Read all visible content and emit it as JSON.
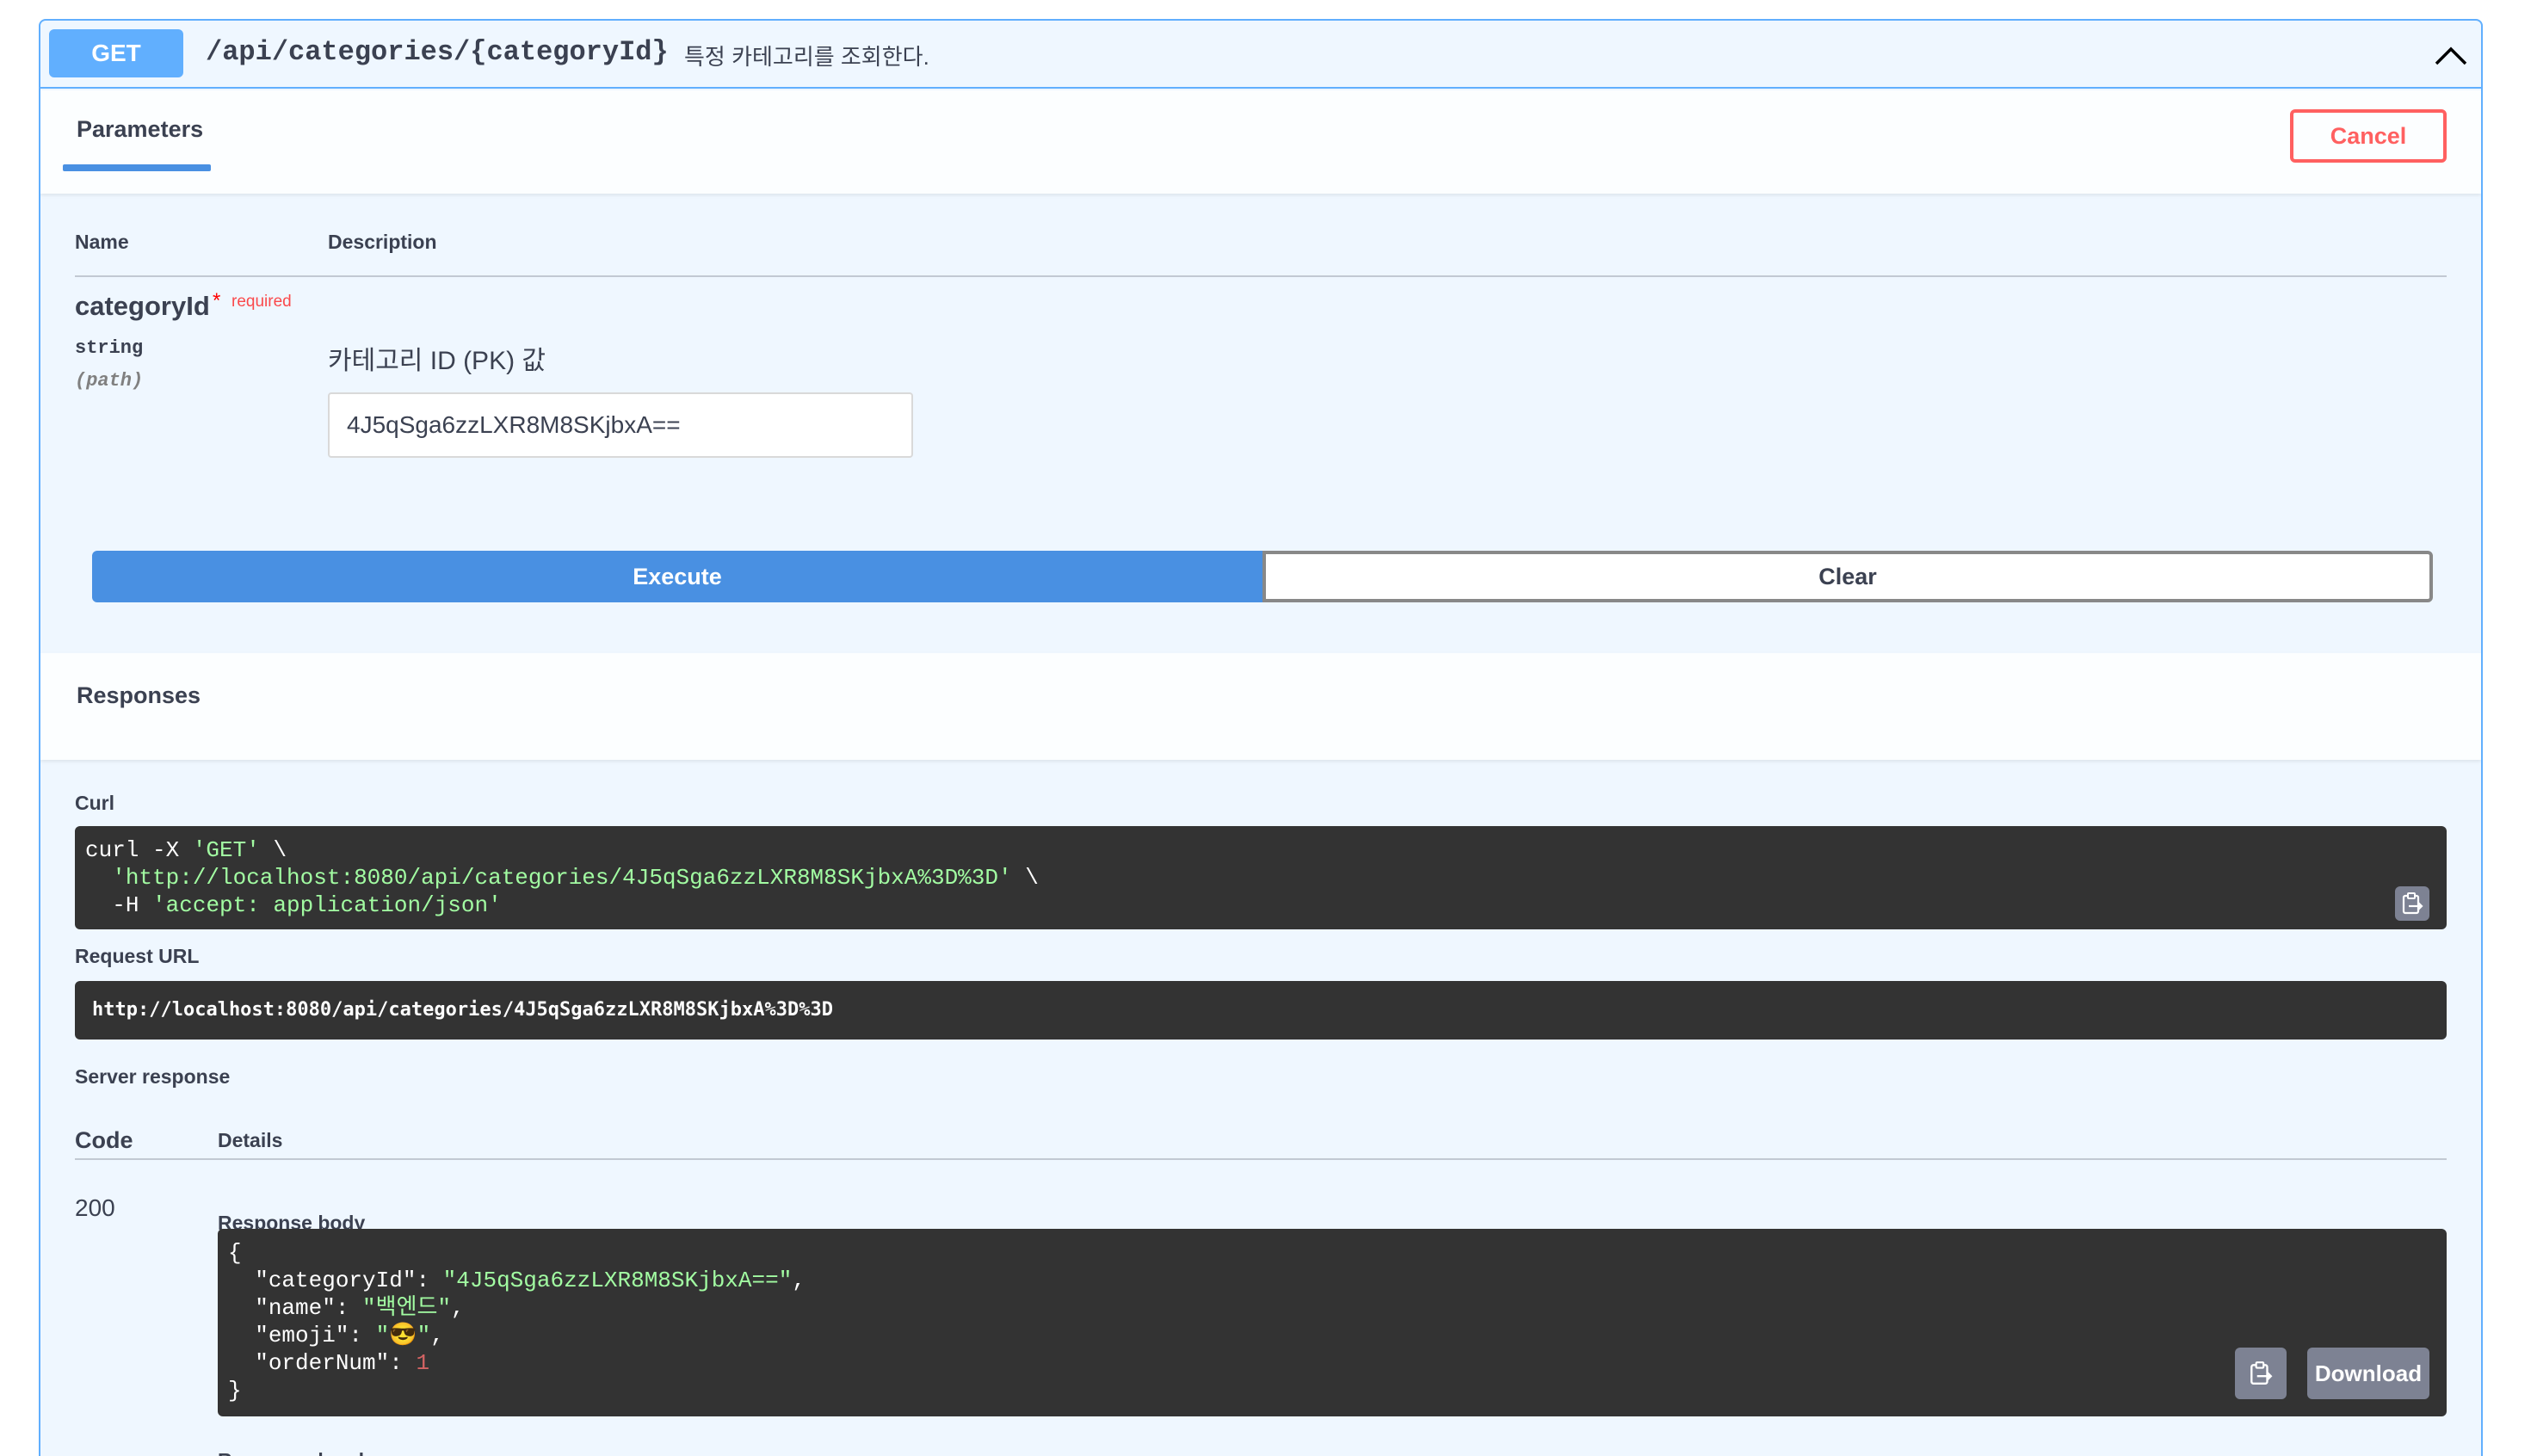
{
  "operation": {
    "method": "GET",
    "path": "/api/categories/{categoryId}",
    "summary": "특정 카테고리를 조회한다."
  },
  "parameters_section": {
    "tab_label": "Parameters",
    "cancel_label": "Cancel",
    "col_name": "Name",
    "col_description": "Description",
    "param": {
      "name": "categoryId",
      "required_star": "*",
      "required_label": "required",
      "type": "string",
      "in": "(path)",
      "description": "카테고리 ID (PK) 값",
      "value": "4J5qSga6zzLXR8M8SKjbxA=="
    }
  },
  "actions": {
    "execute_label": "Execute",
    "clear_label": "Clear"
  },
  "responses_section": {
    "title": "Responses",
    "curl_label": "Curl",
    "curl_lines": {
      "l1_cmd": "curl -X ",
      "l1_str": "'GET'",
      "l1_end": " \\",
      "l2_str": "'http://localhost:8080/api/categories/4J5qSga6zzLXR8M8SKjbxA%3D%3D'",
      "l2_end": " \\",
      "l3_cmd": "-H ",
      "l3_str": "'accept: application/json'"
    },
    "request_url_label": "Request URL",
    "request_url": "http://localhost:8080/api/categories/4J5qSga6zzLXR8M8SKjbxA%3D%3D",
    "server_response_label": "Server response",
    "col_code": "Code",
    "col_details": "Details",
    "status_code": "200",
    "response_body_label": "Response body",
    "response_body": {
      "open": "{",
      "k1": "\"categoryId\": ",
      "v1": "\"4J5qSga6zzLXR8M8SKjbxA==\"",
      "k2": "\"name\": ",
      "v2": "\"백엔드\"",
      "k3": "\"emoji\": ",
      "v3": "\"😎\"",
      "k4": "\"orderNum\": ",
      "v4": "1",
      "close": "}"
    },
    "download_label": "Download",
    "response_headers_label": "Response headers"
  },
  "colors": {
    "get_accent": "#61affe",
    "execute": "#4990e2",
    "cancel": "#ff6060",
    "code_bg": "#333333"
  }
}
